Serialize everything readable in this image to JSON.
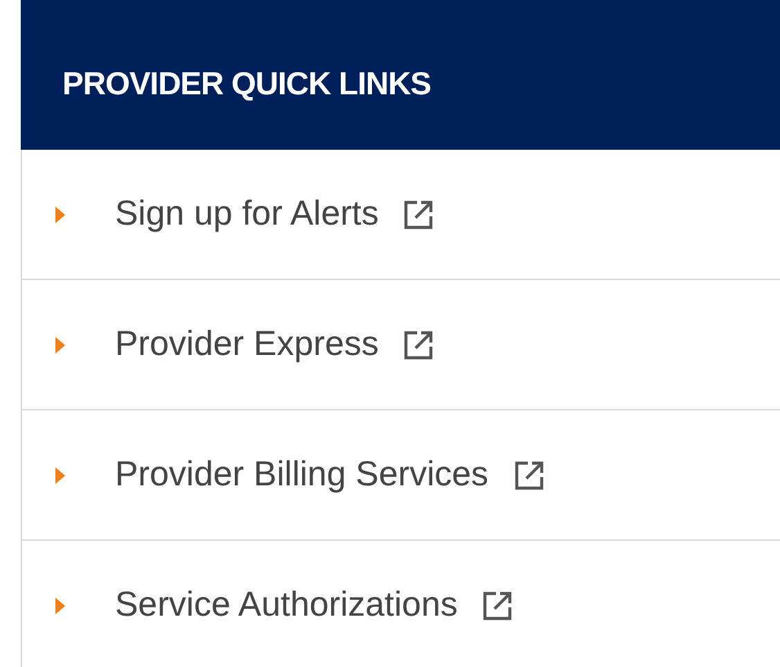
{
  "panel": {
    "title": "PROVIDER QUICK LINKS",
    "links": [
      {
        "label": "Sign up for Alerts"
      },
      {
        "label": "Provider Express"
      },
      {
        "label": "Provider Billing Services"
      },
      {
        "label": "Service Authorizations"
      }
    ]
  }
}
